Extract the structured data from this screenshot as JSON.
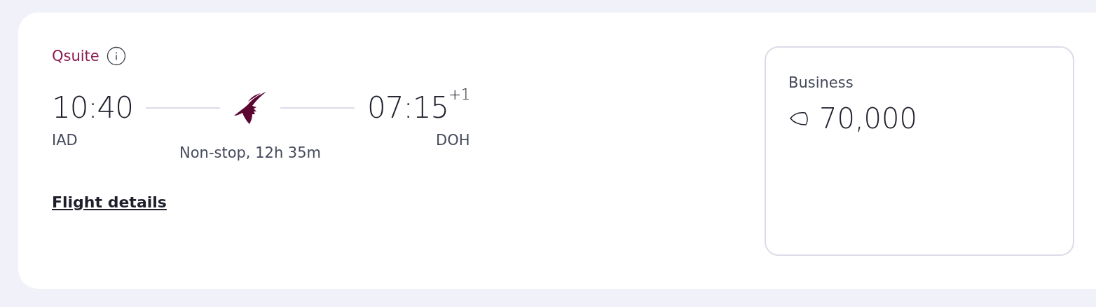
{
  "cabin_label": "Qsuite",
  "departure": {
    "time": "10:40",
    "airport": "IAD"
  },
  "arrival": {
    "time": "07:15",
    "day_offset": "+1",
    "airport": "DOH"
  },
  "duration": "Non-stop, 12h 35m",
  "details_link": "Flight details",
  "fare": {
    "cabin": "Business",
    "price": "70,000"
  }
}
